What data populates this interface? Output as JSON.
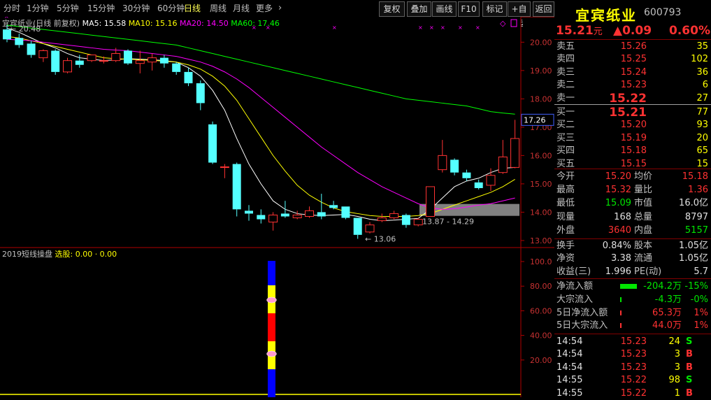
{
  "toolbar": {
    "periods": [
      "分时",
      "1分钟",
      "5分钟",
      "15分钟",
      "30分钟",
      "60分钟",
      "日线",
      "周线",
      "月线",
      "更多"
    ],
    "active_period": "日线",
    "more_chevron_icon": "chevron-right-icon",
    "buttons": [
      "复权",
      "叠加",
      "画线",
      "F10",
      "标记",
      "+自选",
      "返回"
    ]
  },
  "header": {
    "stock_name": "宜宾纸业",
    "stock_code": "600793",
    "price": "15.21",
    "price_unit": "元",
    "change": "▲0.09",
    "change_pct": "0.60%"
  },
  "chart": {
    "legend_title": "宜宾纸业(日线 前复权)",
    "ma5": "MA5: 15.58",
    "ma10": "MA10: 15.16",
    "ma20": "MA20: 14.50",
    "ma60": "MA60: 17.46",
    "high_marker": "20.48",
    "low_marker": "13.06",
    "range_label": "13.87 - 14.29",
    "current_price_tag": "17.26",
    "colors": {
      "up": "#ff3232",
      "down": "#54ffff",
      "ma5": "#ffffff",
      "ma10": "#ffff00",
      "ma20": "#ff00ff",
      "ma60": "#00ff00",
      "axis": "#b00000"
    }
  },
  "chart_data": {
    "type": "candlestick",
    "title": "宜宾纸业(日线 前复权)",
    "y_ticks": [
      20.0,
      19.0,
      18.0,
      17.0,
      16.0,
      15.0,
      14.0,
      13.0
    ],
    "y_tick_labels": [
      "20.00",
      "19.00",
      "18.00",
      "17.00",
      "16.00",
      "15.00",
      "14.00",
      "13.00"
    ],
    "candles": [
      {
        "o": 20.45,
        "h": 20.6,
        "c": 20.1,
        "l": 20.0
      },
      {
        "o": 20.15,
        "h": 20.3,
        "c": 19.9,
        "l": 19.8
      },
      {
        "o": 19.95,
        "h": 20.05,
        "c": 19.55,
        "l": 19.45
      },
      {
        "o": 19.45,
        "h": 19.75,
        "c": 19.7,
        "l": 19.3
      },
      {
        "o": 19.7,
        "h": 19.75,
        "c": 18.95,
        "l": 18.85
      },
      {
        "o": 18.95,
        "h": 19.45,
        "c": 19.35,
        "l": 18.9
      },
      {
        "o": 19.35,
        "h": 19.55,
        "c": 19.2,
        "l": 19.1
      },
      {
        "o": 19.35,
        "h": 19.5,
        "c": 19.55,
        "l": 19.3
      },
      {
        "o": 19.35,
        "h": 19.5,
        "c": 19.35,
        "l": 19.25
      },
      {
        "o": 19.35,
        "h": 19.8,
        "c": 19.6,
        "l": 19.3
      },
      {
        "o": 19.7,
        "h": 19.75,
        "c": 19.25,
        "l": 19.2
      },
      {
        "o": 19.25,
        "h": 19.7,
        "c": 19.35,
        "l": 18.9
      },
      {
        "o": 19.3,
        "h": 19.6,
        "c": 19.45,
        "l": 19.0
      },
      {
        "o": 19.45,
        "h": 19.55,
        "c": 19.25,
        "l": 19.1
      },
      {
        "o": 19.25,
        "h": 19.3,
        "c": 18.95,
        "l": 18.85
      },
      {
        "o": 18.95,
        "h": 19.1,
        "c": 18.55,
        "l": 18.45
      },
      {
        "o": 18.55,
        "h": 18.65,
        "c": 17.85,
        "l": 17.6
      },
      {
        "o": 17.1,
        "h": 17.2,
        "c": 15.75,
        "l": 15.7
      },
      {
        "o": 15.6,
        "h": 15.7,
        "c": 15.6,
        "l": 15.2
      },
      {
        "o": 15.7,
        "h": 15.75,
        "c": 14.1,
        "l": 13.85
      },
      {
        "o": 14.05,
        "h": 14.25,
        "c": 13.95,
        "l": 13.7
      },
      {
        "o": 13.9,
        "h": 14.1,
        "c": 13.75,
        "l": 13.6
      },
      {
        "o": 13.65,
        "h": 14.0,
        "c": 13.9,
        "l": 13.35
      },
      {
        "o": 13.95,
        "h": 14.4,
        "c": 13.85,
        "l": 13.8
      },
      {
        "o": 13.8,
        "h": 14.05,
        "c": 13.9,
        "l": 13.75
      },
      {
        "o": 13.85,
        "h": 14.2,
        "c": 14.05,
        "l": 13.8
      },
      {
        "o": 14.0,
        "h": 14.65,
        "c": 13.85,
        "l": 13.75
      },
      {
        "o": 14.25,
        "h": 14.4,
        "c": 14.15,
        "l": 14.1
      },
      {
        "o": 14.2,
        "h": 14.2,
        "c": 13.8,
        "l": 13.75
      },
      {
        "o": 13.8,
        "h": 13.8,
        "c": 13.2,
        "l": 13.06
      },
      {
        "o": 13.3,
        "h": 13.65,
        "c": 13.55,
        "l": 13.25
      },
      {
        "o": 13.7,
        "h": 13.95,
        "c": 13.8,
        "l": 13.65
      },
      {
        "o": 13.8,
        "h": 14.05,
        "c": 13.95,
        "l": 13.75
      },
      {
        "o": 13.9,
        "h": 13.95,
        "c": 13.55,
        "l": 13.45
      },
      {
        "o": 13.55,
        "h": 13.8,
        "c": 13.75,
        "l": 13.5
      },
      {
        "o": 13.85,
        "h": 14.9,
        "c": 14.9,
        "l": 13.85
      },
      {
        "o": 15.5,
        "h": 16.55,
        "c": 16.0,
        "l": 15.4
      },
      {
        "o": 15.85,
        "h": 15.9,
        "c": 15.4,
        "l": 15.3
      },
      {
        "o": 15.4,
        "h": 15.5,
        "c": 15.2,
        "l": 15.1
      },
      {
        "o": 15.05,
        "h": 15.15,
        "c": 14.85,
        "l": 14.8
      },
      {
        "o": 14.95,
        "h": 15.55,
        "c": 15.3,
        "l": 14.75
      },
      {
        "o": 15.4,
        "h": 16.55,
        "c": 15.95,
        "l": 15.35
      },
      {
        "o": 15.58,
        "h": 17.26,
        "c": 16.6,
        "l": 15.55
      }
    ],
    "ma_series": [
      {
        "name": "MA5",
        "color": "#ffffff",
        "values": [
          20.5,
          20.35,
          20.15,
          19.95,
          19.8,
          19.6,
          19.45,
          19.4,
          19.35,
          19.38,
          19.42,
          19.4,
          19.38,
          19.35,
          19.3,
          19.1,
          18.8,
          18.3,
          17.6,
          16.6,
          15.7,
          15.0,
          14.4,
          14.1,
          13.95,
          13.9,
          13.88,
          13.9,
          13.92,
          13.85,
          13.75,
          13.7,
          13.72,
          13.75,
          13.78,
          14.1,
          14.5,
          14.9,
          15.1,
          15.2,
          15.4,
          15.55,
          15.58
        ]
      },
      {
        "name": "MA10",
        "color": "#ffff00",
        "values": [
          20.2,
          20.15,
          20.05,
          19.95,
          19.85,
          19.75,
          19.65,
          19.55,
          19.45,
          19.42,
          19.4,
          19.38,
          19.36,
          19.33,
          19.3,
          19.2,
          19.05,
          18.8,
          18.45,
          17.95,
          17.3,
          16.65,
          16.0,
          15.45,
          14.95,
          14.6,
          14.35,
          14.15,
          14.02,
          13.95,
          13.88,
          13.85,
          13.85,
          13.85,
          13.88,
          13.95,
          14.1,
          14.25,
          14.4,
          14.55,
          14.7,
          14.9,
          15.16
        ]
      },
      {
        "name": "MA20",
        "color": "#ff00ff",
        "values": [
          20.1,
          20.08,
          20.05,
          20.0,
          19.95,
          19.9,
          19.85,
          19.8,
          19.75,
          19.72,
          19.7,
          19.65,
          19.6,
          19.55,
          19.5,
          19.4,
          19.3,
          19.15,
          18.95,
          18.7,
          18.4,
          18.05,
          17.7,
          17.35,
          17.0,
          16.65,
          16.3,
          16.0,
          15.7,
          15.4,
          15.15,
          14.9,
          14.7,
          14.5,
          14.3,
          14.15,
          14.1,
          14.12,
          14.18,
          14.25,
          14.3,
          14.4,
          14.5
        ]
      },
      {
        "name": "MA60",
        "color": "#00ff00",
        "values": [
          20.6,
          20.55,
          20.5,
          20.45,
          20.4,
          20.35,
          20.3,
          20.25,
          20.2,
          20.15,
          20.1,
          20.05,
          20.0,
          19.95,
          19.9,
          19.8,
          19.7,
          19.6,
          19.5,
          19.4,
          19.3,
          19.2,
          19.1,
          19.0,
          18.9,
          18.8,
          18.7,
          18.6,
          18.5,
          18.4,
          18.3,
          18.2,
          18.1,
          18.0,
          17.95,
          17.9,
          17.85,
          17.8,
          17.75,
          17.65,
          17.55,
          17.5,
          17.46
        ]
      }
    ],
    "range_box": {
      "from": 13.87,
      "to": 14.29
    }
  },
  "indicator": {
    "title": "2019短线操盘",
    "value_label": "选股: 0.00 · 0.00",
    "y_ticks": [
      100.0,
      80.0,
      60.0,
      40.0,
      20.0
    ],
    "y_tick_labels": [
      "100.0",
      "80.00",
      "60.00",
      "40.00",
      "20.00"
    ]
  },
  "orderbook": {
    "asks": [
      {
        "label": "卖五",
        "price": "15.26",
        "vol": "35"
      },
      {
        "label": "卖四",
        "price": "15.25",
        "vol": "102"
      },
      {
        "label": "卖三",
        "price": "15.24",
        "vol": "36"
      },
      {
        "label": "卖二",
        "price": "15.23",
        "vol": "6"
      },
      {
        "label": "卖一",
        "price": "15.22",
        "vol": "27"
      }
    ],
    "bids": [
      {
        "label": "买一",
        "price": "15.21",
        "vol": "77"
      },
      {
        "label": "买二",
        "price": "15.20",
        "vol": "93"
      },
      {
        "label": "买三",
        "price": "15.19",
        "vol": "20"
      },
      {
        "label": "买四",
        "price": "15.18",
        "vol": "65"
      },
      {
        "label": "买五",
        "price": "15.15",
        "vol": "15"
      }
    ]
  },
  "stats": {
    "open_label": "今开",
    "open": "15.20",
    "avg_label": "均价",
    "avg": "15.18",
    "high_label": "最高",
    "high": "15.32",
    "ratio_label": "量比",
    "ratio": "1.36",
    "low_label": "最低",
    "low": "15.09",
    "mcap_label": "市值",
    "mcap": "16.0亿",
    "cur_label": "现量",
    "cur": "168",
    "total_label": "总量",
    "total": "8797",
    "out_label": "外盘",
    "out": "3640",
    "in_label": "内盘",
    "in": "5157",
    "turn_label": "换手",
    "turn": "0.84%",
    "share_label": "股本",
    "share": "1.05亿",
    "nav_label": "净资",
    "nav": "3.38",
    "float_label": "流通",
    "float": "1.05亿",
    "eps_label": "收益(三)",
    "eps": "1.996",
    "pe_label": "PE(动)",
    "pe": "5.7"
  },
  "flows": [
    {
      "label": "净流入额",
      "value": "-204.2万",
      "pct": "-15%",
      "color": "#00e600",
      "bar": 0.6,
      "bar_color": "#00e600"
    },
    {
      "label": "大宗流入",
      "value": "-4.3万",
      "pct": "-0%",
      "color": "#00e600",
      "bar": 0.02,
      "bar_color": "#00e600"
    },
    {
      "label": "5日净流入额",
      "value": "65.3万",
      "pct": "1%",
      "color": "#ff3232",
      "bar": 0.04,
      "bar_color": "#ff3232"
    },
    {
      "label": "5日大宗流入",
      "value": "44.0万",
      "pct": "1%",
      "color": "#ff3232",
      "bar": 0.03,
      "bar_color": "#ff3232"
    }
  ],
  "ticks": [
    {
      "time": "14:54",
      "price": "15.23",
      "vol": "24",
      "side": "S"
    },
    {
      "time": "14:54",
      "price": "15.23",
      "vol": "3",
      "side": "B"
    },
    {
      "time": "14:54",
      "price": "15.23",
      "vol": "3",
      "side": "B"
    },
    {
      "time": "14:55",
      "price": "15.22",
      "vol": "98",
      "side": "S"
    },
    {
      "time": "14:55",
      "price": "15.22",
      "vol": "1",
      "side": "B"
    }
  ],
  "tick_side_colors": {
    "S": "#00e600",
    "B": "#ff3232"
  }
}
